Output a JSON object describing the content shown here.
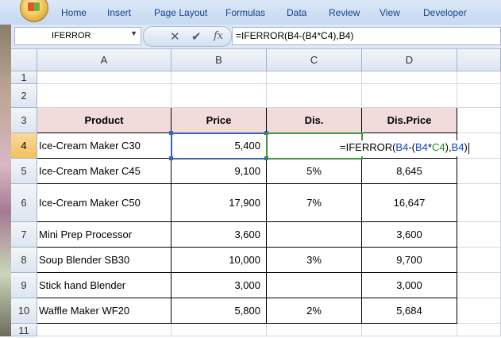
{
  "ribbon": {
    "tabs": [
      "Home",
      "Insert",
      "Page Layout",
      "Formulas",
      "Data",
      "Review",
      "View",
      "Developer"
    ]
  },
  "formula_bar": {
    "name_box": "IFERROR",
    "formula": "=IFERROR(B4-(B4*C4),B4)",
    "icons": [
      "cancel-icon",
      "enter-icon",
      "insert-function-icon"
    ]
  },
  "columns": [
    "A",
    "B",
    "C",
    "D"
  ],
  "rows": [
    "1",
    "2",
    "3",
    "4",
    "5",
    "6",
    "7",
    "8",
    "9",
    "10",
    "11"
  ],
  "table": {
    "headers": [
      "Product",
      "Price",
      "Dis.",
      "Dis.Price"
    ],
    "data": [
      {
        "product": "Ice-Cream Maker C30",
        "price": "5,400",
        "dis": "",
        "disprice": ""
      },
      {
        "product": "Ice-Cream Maker C45",
        "price": "9,100",
        "dis": "5%",
        "disprice": "8,645"
      },
      {
        "product": "Ice-Cream Maker C50",
        "price": "17,900",
        "dis": "7%",
        "disprice": "16,647"
      },
      {
        "product": "Mini Prep Processor",
        "price": "3,600",
        "dis": "",
        "disprice": "3,600"
      },
      {
        "product": "Soup Blender SB30",
        "price": "10,000",
        "dis": "3%",
        "disprice": "9,700"
      },
      {
        "product": "Stick hand Blender",
        "price": "3,000",
        "dis": "",
        "disprice": "3,000"
      },
      {
        "product": "Waffle Maker WF20",
        "price": "5,800",
        "dis": "2%",
        "disprice": "5,684"
      }
    ]
  },
  "edit": {
    "p1": "=IFERROR(",
    "p2": "B4",
    "p3": "-(",
    "p4": "B4",
    "p5": "*",
    "p6": "C4",
    "p7": "),",
    "p8": "B4",
    "p9": ")"
  },
  "colors": {
    "header_fill": "#f2dcdb",
    "ref_blue": "#0b3fd8",
    "ref_green": "#1e8a1e",
    "selected_header": "#f1c15f"
  }
}
